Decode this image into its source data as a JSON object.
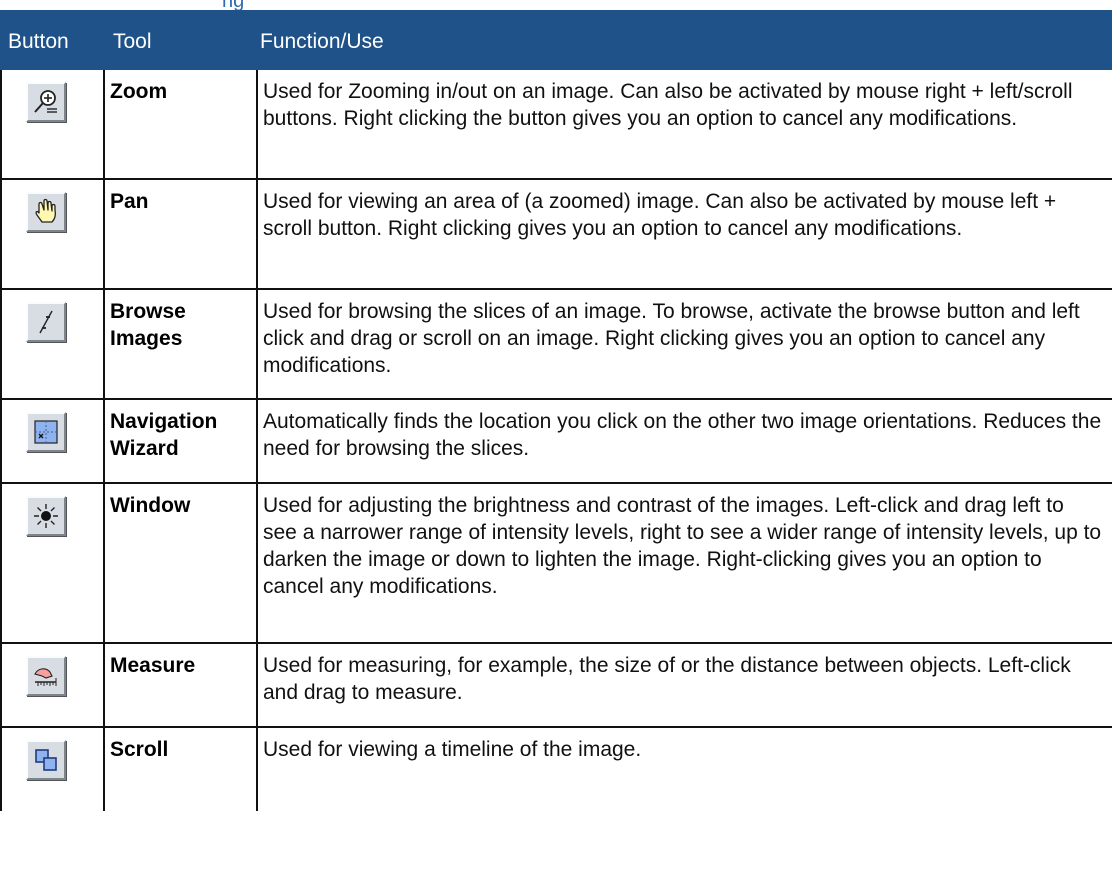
{
  "page": {
    "partial_title": "ng"
  },
  "table": {
    "headers": {
      "button": "Button",
      "tool": "Tool",
      "function": "Function/Use"
    },
    "rows": [
      {
        "tool": "Zoom",
        "icon": "zoom-icon",
        "function": "Used for Zooming in/out on an image. Can also be activated by mouse right + left/scroll buttons. Right clicking the button gives you an option to cancel any modifications."
      },
      {
        "tool": "Pan",
        "icon": "hand-icon",
        "function": "Used for viewing an area of (a zoomed) image. Can also be activated by mouse left + scroll button. Right clicking gives you an option to cancel any modifications."
      },
      {
        "tool": "Browse Images",
        "icon": "browse-line-icon",
        "function": "Used for browsing the slices of an image. To browse, activate the browse button and left click and drag or scroll on an image. Right clicking gives you an option to cancel any modifications."
      },
      {
        "tool": "Navigation Wizard",
        "icon": "navigation-grid-icon",
        "function": "Automatically finds the location you click on the other two image orientations. Reduces the need for browsing the slices."
      },
      {
        "tool": "Window",
        "icon": "brightness-icon",
        "function": "Used for adjusting the brightness and contrast of the images. Left-click and drag left to see a narrower range of intensity levels, right to see a wider range of intensity levels, up to darken the image or down to lighten the image. Right-clicking gives you an option to cancel any modifications."
      },
      {
        "tool": "Measure",
        "icon": "ruler-hand-icon",
        "function": "Used for measuring, for example, the size of or the distance between objects. Left-click and drag to measure."
      },
      {
        "tool": "Scroll",
        "icon": "stacked-squares-icon",
        "function": "Used for viewing a timeline of the image."
      }
    ]
  },
  "colors": {
    "header_background": "#1f5288",
    "header_text": "#ffffff",
    "title_accent": "#2d6ab0",
    "button_face": "#d8dde4"
  }
}
